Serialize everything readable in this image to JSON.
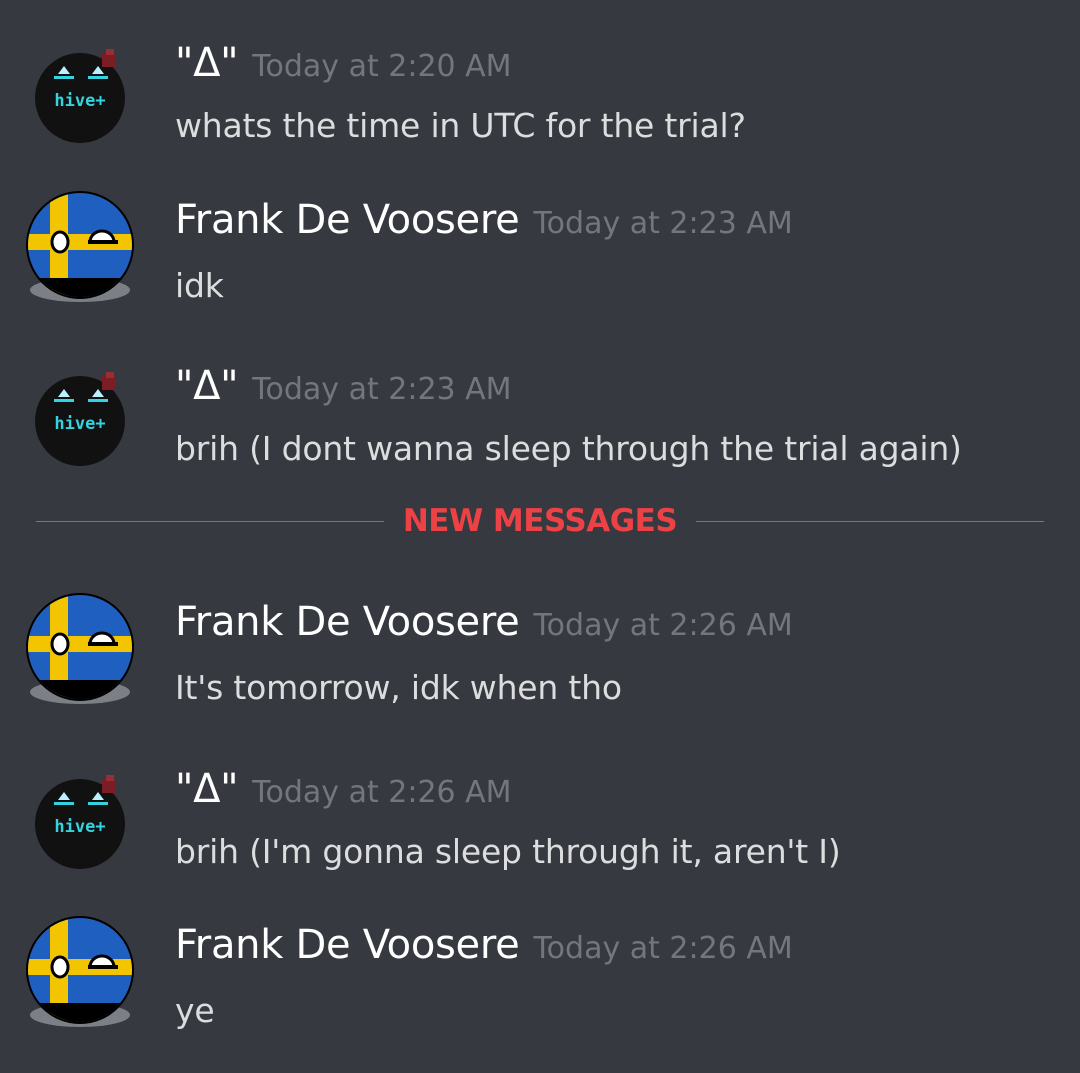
{
  "divider": {
    "label": "NEW MESSAGES"
  },
  "messages": [
    {
      "author": "\"Δ\"",
      "avatar": "hive-bomb-avatar",
      "timestamp": "Today at 2:20 AM",
      "text": "whats the time in UTC for the trial?"
    },
    {
      "author": "Frank De Voosere",
      "avatar": "sweden-ball-avatar",
      "timestamp": "Today at 2:23 AM",
      "text": "idk"
    },
    {
      "author": "\"Δ\"",
      "avatar": "hive-bomb-avatar",
      "timestamp": "Today at 2:23 AM",
      "text": "brih (I dont wanna sleep through the trial again)"
    },
    {
      "author": "Frank De Voosere",
      "avatar": "sweden-ball-avatar",
      "timestamp": "Today at 2:26 AM",
      "text": "It's tomorrow, idk when tho"
    },
    {
      "author": "\"Δ\"",
      "avatar": "hive-bomb-avatar",
      "timestamp": "Today at 2:26 AM",
      "text": "brih (I'm gonna sleep through it, aren't I)"
    },
    {
      "author": "Frank De Voosere",
      "avatar": "sweden-ball-avatar",
      "timestamp": "Today at 2:26 AM",
      "text": "ye"
    }
  ],
  "avatars": {
    "hive_logo_text": "hive+"
  },
  "colors": {
    "background": "#36393f",
    "username": "#ffffff",
    "timestamp": "#72767d",
    "message_text": "#dcddde",
    "new_messages": "#ed4245",
    "hive_accent": "#35d3e0",
    "sweden_blue": "#1f5fbf",
    "sweden_yellow": "#f2c500"
  }
}
